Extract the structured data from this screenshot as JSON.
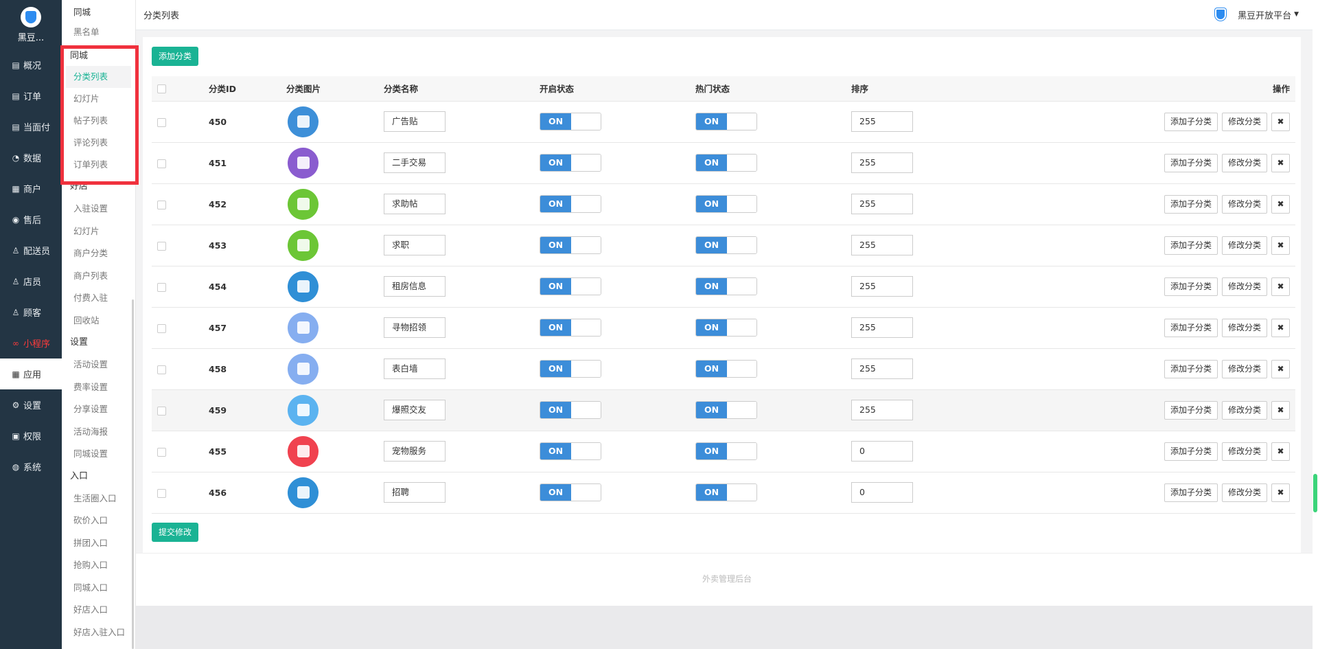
{
  "nav": {
    "brand": "黑豆...",
    "items": [
      {
        "label": "概况",
        "icon": "overview-icon",
        "glyph": "▤"
      },
      {
        "label": "订单",
        "icon": "order-icon",
        "glyph": "▤"
      },
      {
        "label": "当面付",
        "icon": "pay-icon",
        "glyph": "▤"
      },
      {
        "label": "数据",
        "icon": "data-icon",
        "glyph": "◔"
      },
      {
        "label": "商户",
        "icon": "merchant-icon",
        "glyph": "▦"
      },
      {
        "label": "售后",
        "icon": "aftersale-icon",
        "glyph": "◉"
      },
      {
        "label": "配送员",
        "icon": "courier-icon",
        "glyph": "♙"
      },
      {
        "label": "店员",
        "icon": "clerk-icon",
        "glyph": "♙"
      },
      {
        "label": "顾客",
        "icon": "customer-icon",
        "glyph": "♙"
      },
      {
        "label": "小程序",
        "icon": "miniprogram-icon",
        "glyph": "∞"
      },
      {
        "label": "应用",
        "icon": "apps-icon",
        "glyph": "▦"
      },
      {
        "label": "设置",
        "icon": "settings-icon",
        "glyph": "⚙"
      },
      {
        "label": "权限",
        "icon": "lock-icon",
        "glyph": "▣"
      },
      {
        "label": "系统",
        "icon": "system-icon",
        "glyph": "◍"
      }
    ]
  },
  "subnav": {
    "top": [
      "同城",
      "黑名单"
    ],
    "groups": [
      {
        "title": "同城",
        "items": [
          "分类列表",
          "幻灯片",
          "帖子列表",
          "评论列表",
          "订单列表"
        ]
      },
      {
        "title": "好店",
        "items": [
          "入驻设置",
          "幻灯片",
          "商户分类",
          "商户列表",
          "付费入驻",
          "回收站"
        ]
      },
      {
        "title": "设置",
        "items": [
          "活动设置",
          "费率设置",
          "分享设置",
          "活动海报",
          "同城设置"
        ]
      },
      {
        "title": "入口",
        "items": [
          "生活圈入口",
          "砍价入口",
          "拼团入口",
          "抢购入口",
          "同城入口",
          "好店入口",
          "好店入驻入口"
        ]
      }
    ]
  },
  "topbar": {
    "title": "分类列表",
    "platform": "黑豆开放平台"
  },
  "toolbar": {
    "add_label": "添加分类",
    "submit_label": "提交修改"
  },
  "table": {
    "headers": [
      "分类ID",
      "分类图片",
      "分类名称",
      "开启状态",
      "热门状态",
      "排序",
      "操作"
    ],
    "ops": {
      "add_sub": "添加子分类",
      "edit": "修改分类",
      "delete": "✖"
    },
    "rows": [
      {
        "id": "450",
        "name": "广告贴",
        "open": "ON",
        "hot": "ON",
        "sort": "255",
        "color": "#3d8fd8",
        "icon": "building-icon"
      },
      {
        "id": "451",
        "name": "二手交易",
        "open": "ON",
        "hot": "ON",
        "sort": "255",
        "color": "#8a5ccf",
        "icon": "bag-icon"
      },
      {
        "id": "452",
        "name": "求助帖",
        "open": "ON",
        "hot": "ON",
        "sort": "255",
        "color": "#6cc636",
        "icon": "book-icon"
      },
      {
        "id": "453",
        "name": "求职",
        "open": "ON",
        "hot": "ON",
        "sort": "255",
        "color": "#6cc636",
        "icon": "book-icon"
      },
      {
        "id": "454",
        "name": "租房信息",
        "open": "ON",
        "hot": "ON",
        "sort": "255",
        "color": "#2f8fd6",
        "icon": "house-pin-icon"
      },
      {
        "id": "457",
        "name": "寻物招领",
        "open": "ON",
        "hot": "ON",
        "sort": "255",
        "color": "#86aef0",
        "icon": "box-icon"
      },
      {
        "id": "458",
        "name": "表白墙",
        "open": "ON",
        "hot": "ON",
        "sort": "255",
        "color": "#86aef0",
        "icon": "box-icon"
      },
      {
        "id": "459",
        "name": "爆照交友",
        "open": "ON",
        "hot": "ON",
        "sort": "255",
        "color": "#5bb3f0",
        "icon": "photo-icon"
      },
      {
        "id": "455",
        "name": "宠物服务",
        "open": "ON",
        "hot": "ON",
        "sort": "0",
        "color": "#f0424f",
        "icon": "cat-icon"
      },
      {
        "id": "456",
        "name": "招聘",
        "open": "ON",
        "hot": "ON",
        "sort": "0",
        "color": "#2f8fd6",
        "icon": "house-pin-icon"
      }
    ]
  },
  "footer": {
    "text": "外卖管理后台"
  }
}
